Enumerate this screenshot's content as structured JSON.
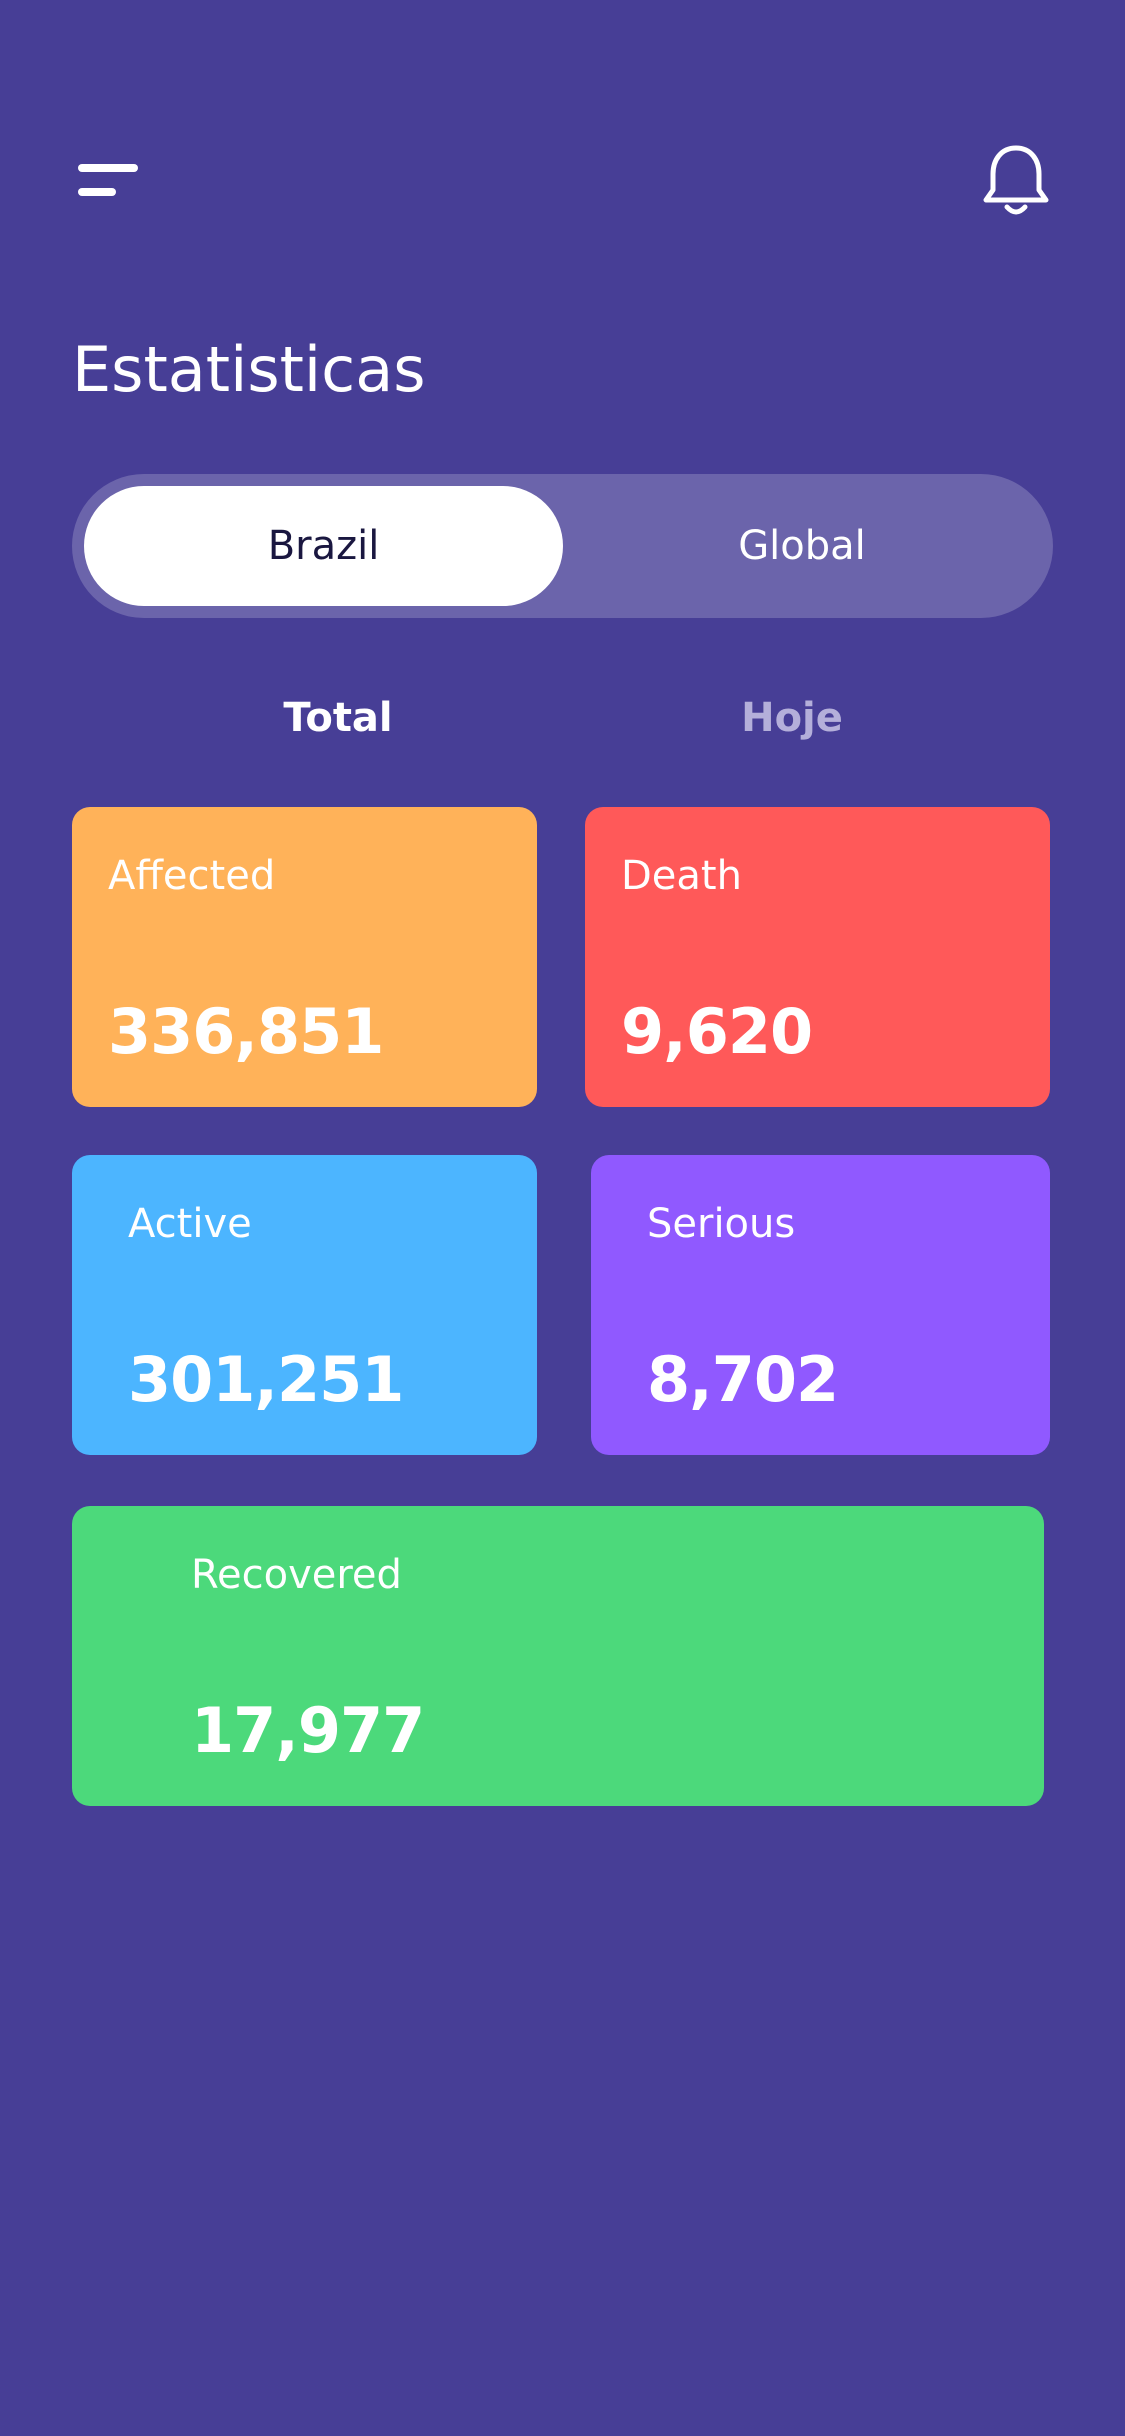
{
  "header": {
    "menu_icon": "menu-icon",
    "notification_icon": "bell-icon"
  },
  "page": {
    "title": "Estatisticas"
  },
  "region_selector": {
    "options": [
      "Brazil",
      "Global"
    ],
    "selected": "Brazil"
  },
  "period_tabs": {
    "options": [
      "Total",
      "Hoje"
    ],
    "selected": "Total"
  },
  "stats": {
    "affected": {
      "label": "Affected",
      "value": "336,851",
      "color": "#FFB259"
    },
    "death": {
      "label": "Death",
      "value": "9,620",
      "color": "#FF5959"
    },
    "active": {
      "label": "Active",
      "value": "301,251",
      "color": "#4CB5FF"
    },
    "serious": {
      "label": "Serious",
      "value": "8,702",
      "color": "#9059FF"
    },
    "recovered": {
      "label": "Recovered",
      "value": "17,977",
      "color": "#4CD97B"
    }
  },
  "colors": {
    "background": "#473E96",
    "segment_track": "#6B64AB",
    "inactive_tab": "#B4AFDA"
  }
}
